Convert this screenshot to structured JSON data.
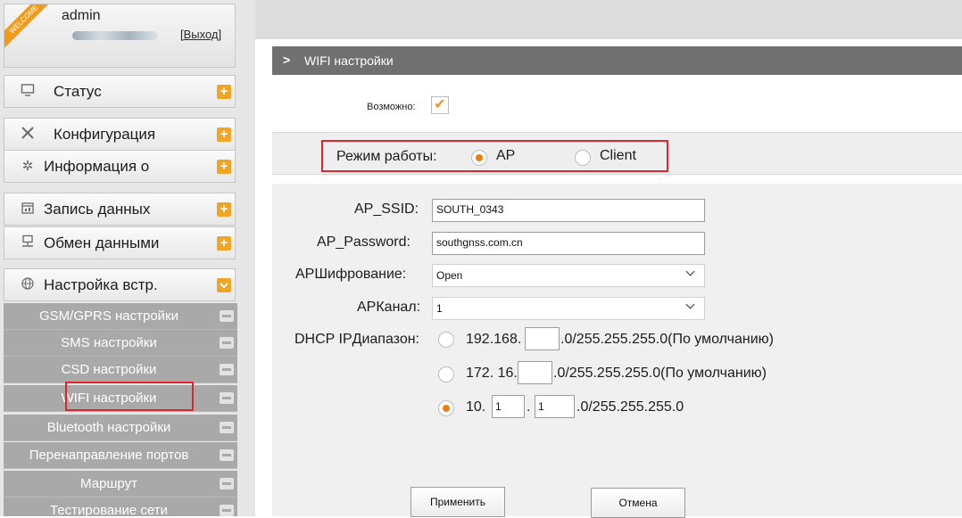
{
  "user": {
    "welcome": "WELCOME",
    "name": "admin",
    "logout": "[Выход]"
  },
  "sidebar": {
    "menu": [
      {
        "label": "Статус",
        "icon": "monitor-icon"
      },
      {
        "label": "Конфигурация",
        "icon": "tools-icon"
      },
      {
        "label": "Информация о",
        "icon": "satellite-icon"
      },
      {
        "label": "Запись данных",
        "icon": "calendar-icon"
      },
      {
        "label": "Обмен данными",
        "icon": "network-icon"
      },
      {
        "label": "Настройка встр.",
        "icon": "globe-icon"
      }
    ],
    "submenu": [
      {
        "label": "GSM/GPRS настройки"
      },
      {
        "label": "SMS настройки"
      },
      {
        "label": "CSD настройки"
      },
      {
        "label": "WIFI настройки"
      },
      {
        "label": "Bluetooth настройки"
      },
      {
        "label": "Перенаправление портов"
      },
      {
        "label": "Маршрут"
      },
      {
        "label": "Тестирование сети"
      }
    ]
  },
  "page": {
    "title": "WIFI настройки"
  },
  "form": {
    "enable_label": "Возможно:",
    "enable_checked": true,
    "mode_label": "Режим работы:",
    "mode_options": [
      "AP",
      "Client"
    ],
    "mode_selected": "AP",
    "ssid_label": "AP_SSID:",
    "ssid_value": "SOUTH_0343",
    "password_label": "AP_Password:",
    "password_value": "southgnss.com.cn",
    "encryption_label": "APШифрование:",
    "encryption_value": "Open",
    "channel_label": "APКанал:",
    "channel_value": "1",
    "dhcp_label": "DHCP IPДиапазон:",
    "dhcp_options": [
      {
        "prefix": "192.168.",
        "suffix": ".0/255.255.255.0(По умолчанию)",
        "value1": ""
      },
      {
        "prefix": "172. 16.",
        "suffix": ".0/255.255.255.0(По умолчанию)",
        "value1": ""
      },
      {
        "prefix": "10.",
        "separator": ".",
        "suffix": ".0/255.255.255.0",
        "value1": "1",
        "value2": "1"
      }
    ],
    "dhcp_selected": 2,
    "apply_button": "Применить",
    "cancel_button": "Отмена"
  },
  "colors": {
    "accent": "#f0a524",
    "highlight": "#e0242c",
    "title_bar": "#707070",
    "submenu_bg": "#a9a9a9"
  }
}
